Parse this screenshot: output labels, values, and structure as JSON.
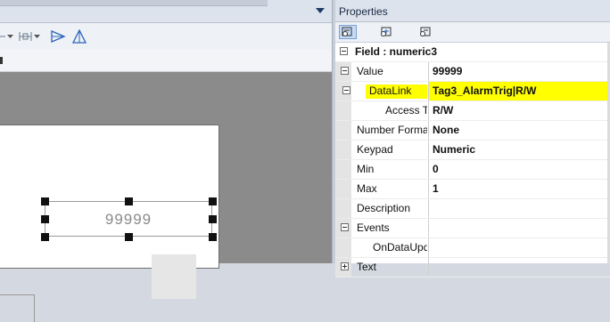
{
  "properties_panel": {
    "title": "Properties",
    "toolbar_icons": [
      "property-grid-icon",
      "events-grid-icon",
      "categorized-icon"
    ],
    "section_header": "Field : numeric3",
    "rows": {
      "value": {
        "name": "Value",
        "value": "99999"
      },
      "datalink": {
        "name": "DataLink",
        "value": "Tag3_AlarmTrig|R/W"
      },
      "access_type": {
        "name": "Access Type",
        "value": "R/W"
      },
      "number_format": {
        "name": "Number Format",
        "value": "None"
      },
      "keypad": {
        "name": "Keypad",
        "value": "Numeric"
      },
      "min": {
        "name": "Min",
        "value": "0"
      },
      "max": {
        "name": "Max",
        "value": "1"
      },
      "description": {
        "name": "Description",
        "value": ""
      },
      "events": {
        "name": "Events",
        "value": ""
      },
      "on_data_update": {
        "name": "OnDataUpdate",
        "value": ""
      },
      "text": {
        "name": "Text",
        "value": ""
      }
    }
  },
  "designer": {
    "field_value": "99999",
    "toolbar_icons": [
      "distribute-icon",
      "dropdown-arrow-icon",
      "distribute-horizontal-icon",
      "dropdown-arrow-icon",
      "flip-horizontal-icon",
      "flip-vertical-icon"
    ]
  },
  "colors": {
    "highlight": "#ffff00",
    "workspace": "#8b8b8b",
    "panel_header": "#dde3ec"
  }
}
